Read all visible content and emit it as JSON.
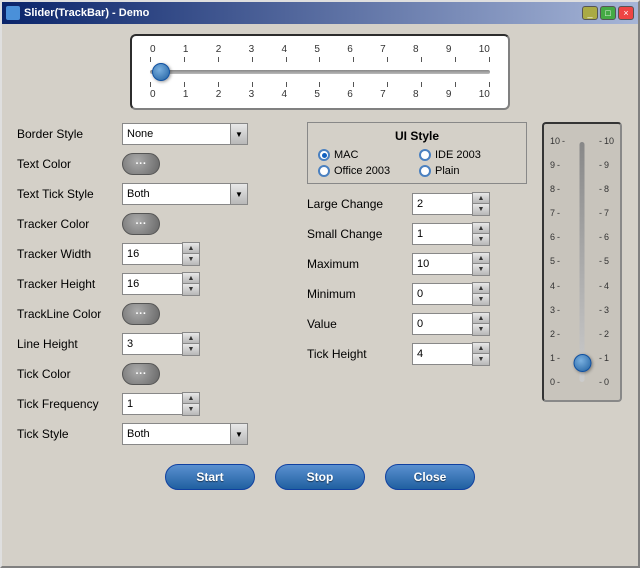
{
  "window": {
    "title": "Slider(TrackBar) - Demo"
  },
  "slider_preview": {
    "tick_labels": [
      "0",
      "1",
      "2",
      "3",
      "4",
      "5",
      "6",
      "7",
      "8",
      "9",
      "10"
    ]
  },
  "ui_style": {
    "title": "UI Style",
    "options": [
      {
        "id": "mac",
        "label": "MAC",
        "checked": true
      },
      {
        "id": "ide2003",
        "label": "IDE 2003",
        "checked": false
      },
      {
        "id": "office2003",
        "label": "Office 2003",
        "checked": false
      },
      {
        "id": "plain",
        "label": "Plain",
        "checked": false
      }
    ]
  },
  "left_controls": {
    "border_style": {
      "label": "Border Style",
      "value": "None"
    },
    "text_color": {
      "label": "Text Color"
    },
    "text_tick_style": {
      "label": "Text Tick Style",
      "value": "Both"
    },
    "tracker_color": {
      "label": "Tracker Color"
    },
    "tracker_width": {
      "label": "Tracker Width",
      "value": "16"
    },
    "tracker_height": {
      "label": "Tracker Height",
      "value": "16"
    },
    "trackline_color": {
      "label": "TrackLine Color"
    },
    "line_height": {
      "label": "Line Height",
      "value": "3"
    },
    "tick_color": {
      "label": "Tick Color"
    },
    "tick_frequency": {
      "label": "Tick Frequency",
      "value": "1"
    },
    "tick_style": {
      "label": "Tick Style",
      "value": "Both"
    }
  },
  "right_controls": {
    "large_change": {
      "label": "Large Change",
      "value": "2"
    },
    "small_change": {
      "label": "Small Change",
      "value": "1"
    },
    "maximum": {
      "label": "Maximum",
      "value": "10"
    },
    "minimum": {
      "label": "Minimum",
      "value": "0"
    },
    "value": {
      "label": "Value",
      "value": "0"
    },
    "tick_height": {
      "label": "Tick Height",
      "value": "4"
    }
  },
  "vertical_slider": {
    "ticks_left": [
      "10",
      "9",
      "8",
      "7",
      "6",
      "5",
      "4",
      "3",
      "2",
      "1",
      "0"
    ],
    "ticks_right": [
      "-10",
      "-9",
      "-8",
      "-7",
      "-6",
      "-5",
      "-4",
      "-3",
      "-2",
      "-1",
      "0"
    ]
  },
  "buttons": {
    "start": "Start",
    "stop": "Stop",
    "close": "Close"
  }
}
